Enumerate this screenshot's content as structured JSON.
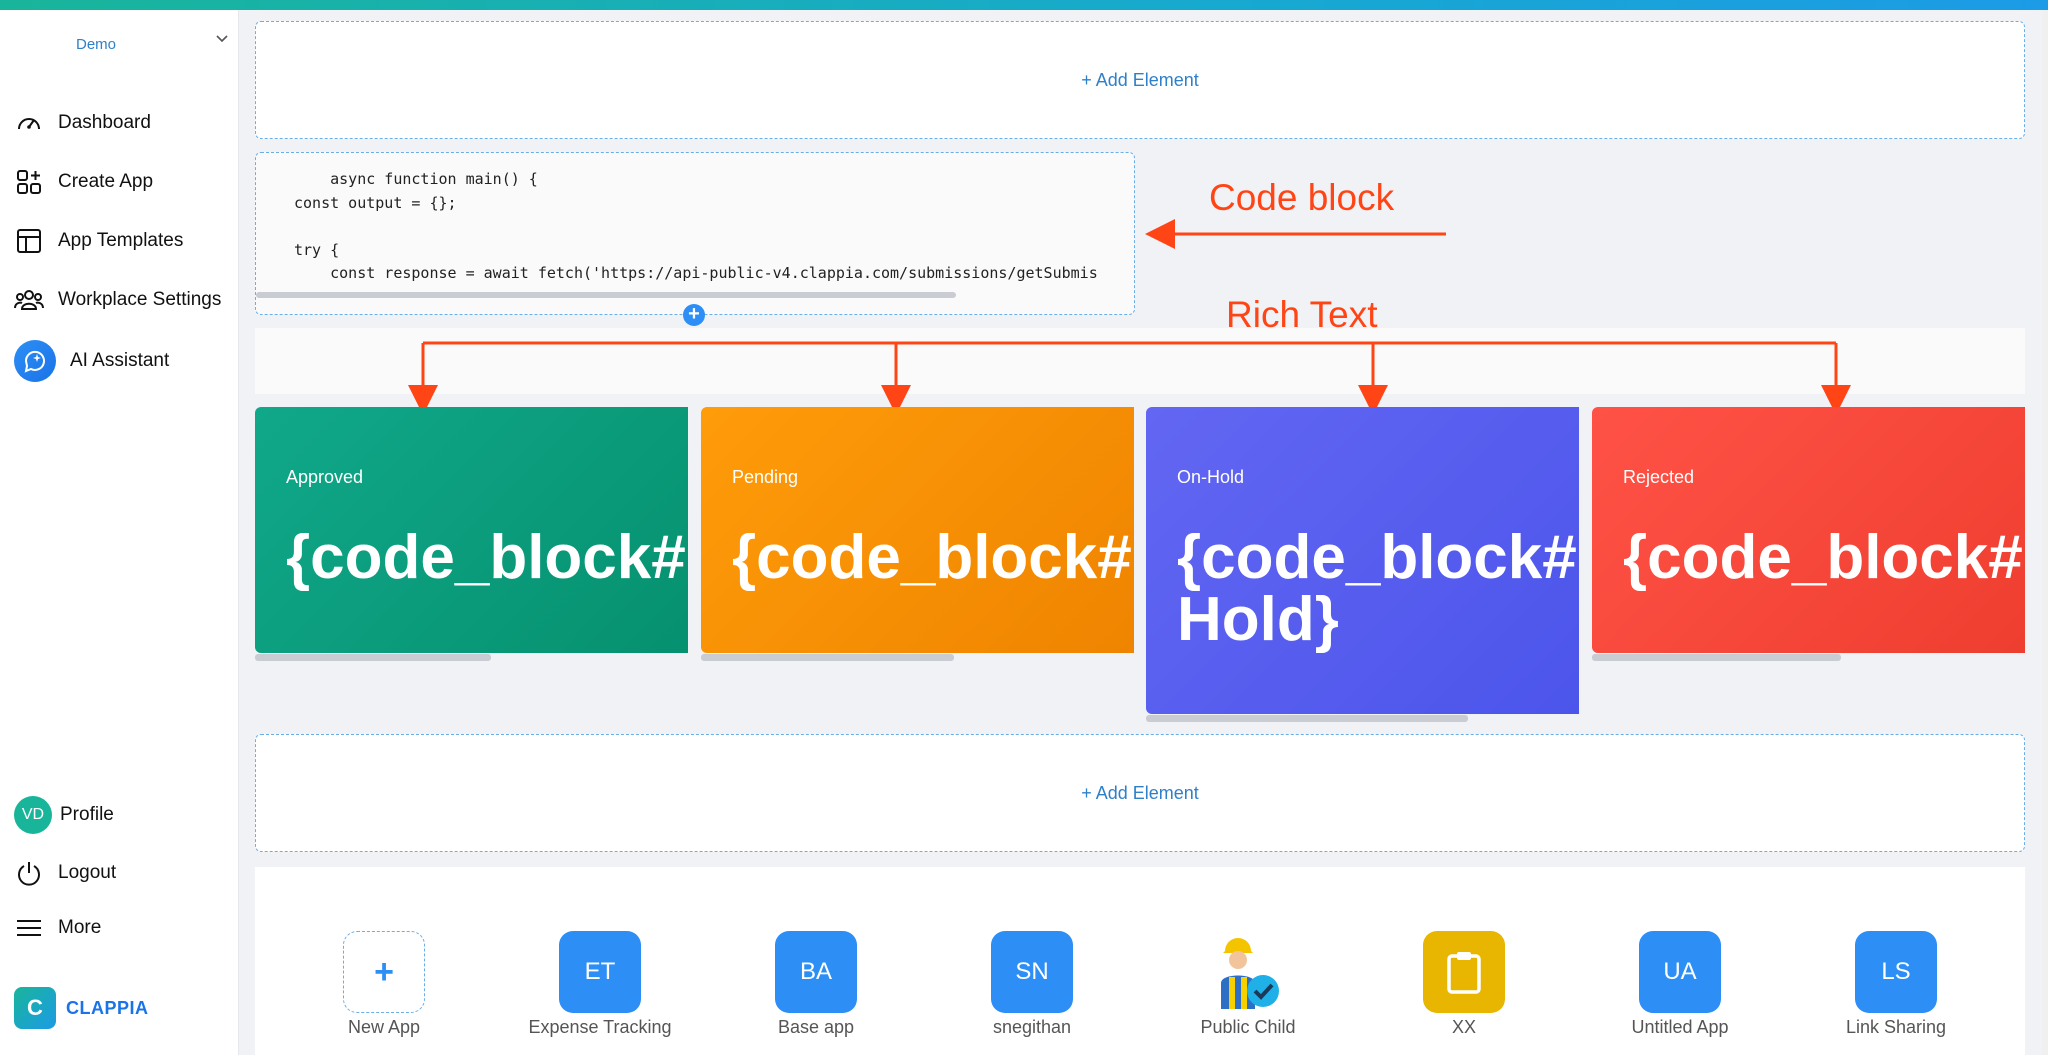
{
  "workspace": {
    "name": "Demo"
  },
  "sidebar": {
    "items": [
      {
        "label": "Dashboard",
        "icon": "dashboard-icon"
      },
      {
        "label": "Create App",
        "icon": "create-app-icon"
      },
      {
        "label": "App Templates",
        "icon": "templates-icon"
      },
      {
        "label": "Workplace Settings",
        "icon": "people-icon"
      },
      {
        "label": "AI Assistant",
        "icon": "ai-assistant-icon"
      }
    ],
    "bottom": [
      {
        "label": "Profile",
        "avatar_initials": "VD"
      },
      {
        "label": "Logout",
        "icon": "power-icon"
      },
      {
        "label": "More",
        "icon": "menu-icon"
      }
    ],
    "logo": {
      "letter": "C",
      "text": "CLAPPIA"
    }
  },
  "main": {
    "add_element_label": "+ Add Element",
    "code_block": {
      "lines": [
        "    async function main() {",
        "const output = {};",
        "",
        "try {",
        "    const response = await fetch('https://api-public-v4.clappia.com/submissions/getSubmis"
      ]
    },
    "annotations": {
      "code_block": "Code block",
      "rich_text": "Rich Text"
    },
    "cards": [
      {
        "label": "Approved",
        "value": "{code_block#",
        "color": "#0f9f7e"
      },
      {
        "label": "Pending",
        "value": "{code_block#",
        "color": "#f59300"
      },
      {
        "label": "On-Hold",
        "value": "{code_block#\nHold}",
        "color": "#5a5ff0"
      },
      {
        "label": "Rejected",
        "value": "{code_block#",
        "color": "#f44a3a"
      }
    ],
    "apps": [
      {
        "name": "New App",
        "tile": "+"
      },
      {
        "name": "Expense Tracking",
        "tile": "ET"
      },
      {
        "name": "Base app",
        "tile": "BA"
      },
      {
        "name": "snegithan",
        "tile": "SN"
      },
      {
        "name": "Public Child",
        "tile": "worker-icon"
      },
      {
        "name": "XX",
        "tile": "clipboard-icon"
      },
      {
        "name": "Untitled App",
        "tile": "UA"
      },
      {
        "name": "Link Sharing",
        "tile": "LS"
      }
    ]
  },
  "colors": {
    "accent": "#2d8ff5",
    "annotation": "#ff4515",
    "brand": "#19b59a"
  }
}
